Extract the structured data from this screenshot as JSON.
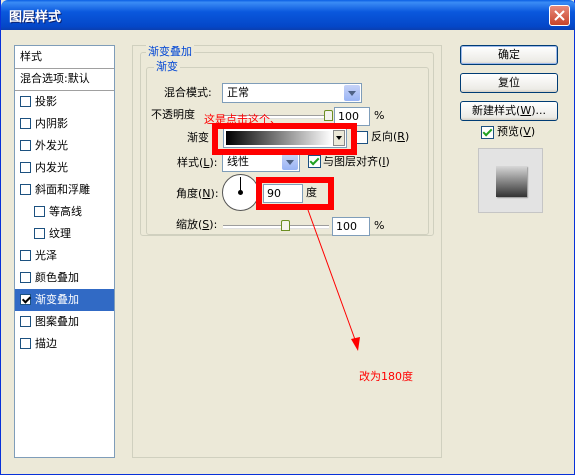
{
  "window": {
    "title": "图层样式",
    "close_icon": "close-icon"
  },
  "style_list": {
    "header": "样式",
    "blend_options": "混合选项:默认",
    "items": [
      {
        "label": "投影",
        "checked": false,
        "indent": false,
        "selected": false
      },
      {
        "label": "内阴影",
        "checked": false,
        "indent": false,
        "selected": false
      },
      {
        "label": "外发光",
        "checked": false,
        "indent": false,
        "selected": false
      },
      {
        "label": "内发光",
        "checked": false,
        "indent": false,
        "selected": false
      },
      {
        "label": "斜面和浮雕",
        "checked": false,
        "indent": false,
        "selected": false
      },
      {
        "label": "等高线",
        "checked": false,
        "indent": true,
        "selected": false
      },
      {
        "label": "纹理",
        "checked": false,
        "indent": true,
        "selected": false
      },
      {
        "label": "光泽",
        "checked": false,
        "indent": false,
        "selected": false
      },
      {
        "label": "颜色叠加",
        "checked": false,
        "indent": false,
        "selected": false
      },
      {
        "label": "渐变叠加",
        "checked": true,
        "indent": false,
        "selected": true
      },
      {
        "label": "图案叠加",
        "checked": false,
        "indent": false,
        "selected": false
      },
      {
        "label": "描边",
        "checked": false,
        "indent": false,
        "selected": false
      }
    ]
  },
  "panel": {
    "section_title": "渐变叠加",
    "subsection_title": "渐变",
    "blend_mode_label": "混合模式:",
    "blend_mode_value": "正常",
    "opacity_label": "不透明度",
    "opacity_value": "100",
    "opacity_slider": 1.0,
    "percent": "%",
    "gradient_label": "渐变",
    "reverse_label": "反向(",
    "reverse_key": "R",
    "reverse_close": ")",
    "reverse_checked": false,
    "style_label": "样式(",
    "style_key": "L",
    "style_close": "):",
    "style_value": "线性",
    "align_label": "与图层对齐(",
    "align_key": "I",
    "align_close": ")",
    "align_checked": true,
    "angle_label": "角度(",
    "angle_key": "N",
    "angle_close": "):",
    "angle_value": "90",
    "degree_label": "度",
    "scale_label": "缩放(",
    "scale_key": "S",
    "scale_close": "):",
    "scale_value": "100",
    "scale_slider": 0.5
  },
  "buttons": {
    "ok": "确定",
    "reset": "复位",
    "new_style": "新建样式(",
    "new_style_key": "W",
    "new_style_close": ")...",
    "preview_label": "预览(",
    "preview_key": "V",
    "preview_close": ")",
    "preview_checked": true
  },
  "annotations": {
    "gradient_note": "这是点击这个、",
    "angle_note": "改为180度",
    "color": "#ff0000"
  }
}
